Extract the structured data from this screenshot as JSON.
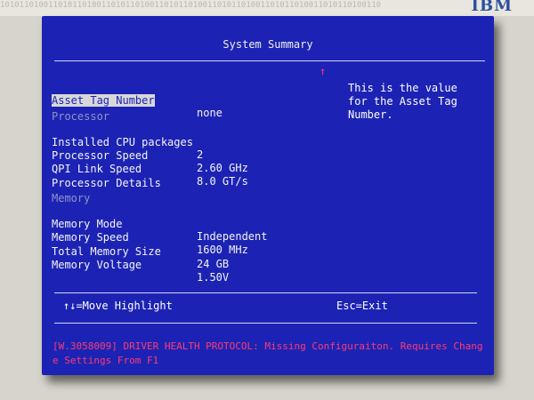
{
  "background": {
    "bits": "1010110100110101101001101011010011010110100110101101001101011010011010110100110",
    "logo": "IBM"
  },
  "screen": {
    "title": "System Summary",
    "scroll_indicator": "↑",
    "fields": [
      {
        "label": "Asset Tag Number",
        "value": "none"
      }
    ],
    "processor": {
      "heading": "Processor",
      "rows": [
        {
          "label": "Installed CPU packages",
          "value": "2"
        },
        {
          "label": "Processor Speed",
          "value": "2.60 GHz"
        },
        {
          "label": "QPI Link Speed",
          "value": "8.0 GT/s"
        },
        {
          "label": "Processor Details",
          "value": ""
        }
      ]
    },
    "memory": {
      "heading": "Memory",
      "rows": [
        {
          "label": "Memory Mode",
          "value": "Independent"
        },
        {
          "label": "Memory Speed",
          "value": "1600 MHz"
        },
        {
          "label": "Total Memory Size",
          "value": "24 GB"
        },
        {
          "label": "Memory Voltage",
          "value": "1.50V"
        }
      ]
    },
    "help_text": "This is the value for the Asset Tag Number.",
    "keys": {
      "move": "↑↓=Move Highlight",
      "exit": "Esc=Exit"
    },
    "error_message": "[W.3058009] DRIVER HEALTH PROTOCOL: Missing Configuraiton. Requires Change Settings From F1"
  },
  "colors": {
    "screen_bg": "#1c23b4",
    "highlight_bg": "#d8d8d8",
    "error_text": "#ff3a73",
    "section_heading": "#8f95c6"
  }
}
